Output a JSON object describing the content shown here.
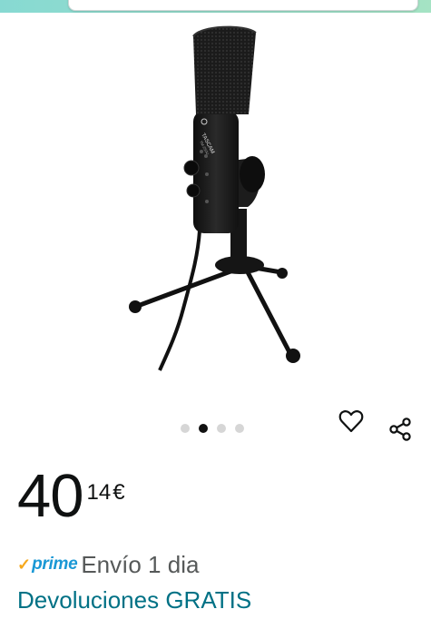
{
  "image_carousel": {
    "image_alt": "TASCAM",
    "mic_brand": "TASCAM",
    "mic_model": "TM-250U",
    "total_images": 4,
    "active_index": 1
  },
  "price": {
    "whole": "40",
    "fraction": "14",
    "currency": "€"
  },
  "shipping": {
    "prime_label": "prime",
    "text": "Envío 1 dia"
  },
  "returns": {
    "text": "Devoluciones GRATIS"
  },
  "icons": {
    "wishlist": "heart-outline-icon",
    "share": "share-icon",
    "prime_check": "check-icon"
  },
  "colors": {
    "top_bar": "#87d9d2",
    "price_text": "#0f1111",
    "prime_blue": "#1a98d5",
    "prime_check": "#f6a81c",
    "link_teal": "#007185",
    "dot_active": "#111111",
    "dot_inactive": "#d6d6d6"
  }
}
